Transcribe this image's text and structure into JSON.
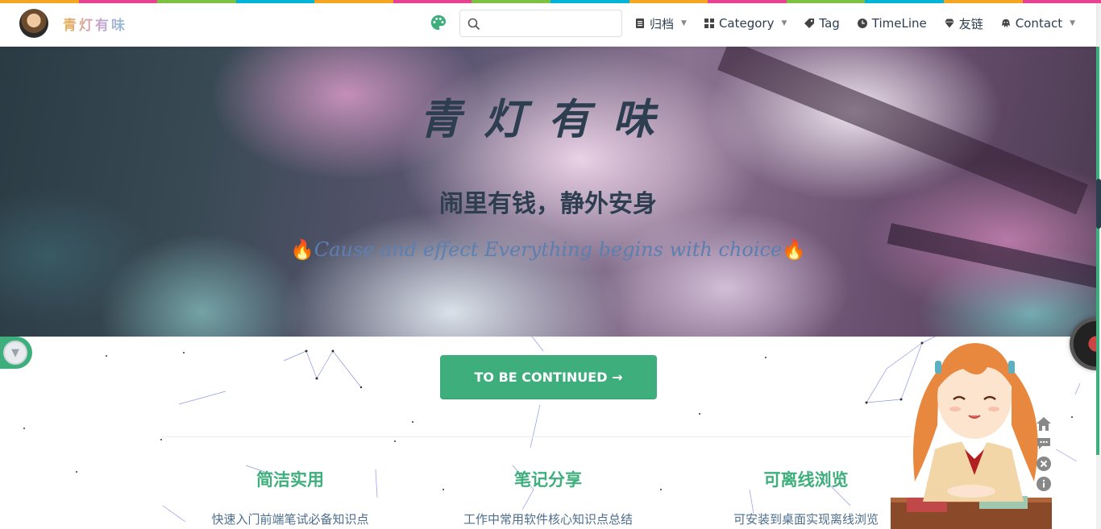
{
  "colors": {
    "accent": "#3eaf7c",
    "text": "#2c3e50",
    "rainbow": [
      "#f5a623",
      "#e84393",
      "#7cc142",
      "#00b4d8",
      "#f5a623",
      "#e84393",
      "#7cc142",
      "#00b4d8",
      "#f5a623",
      "#e84393",
      "#7cc142",
      "#00b4d8",
      "#f5a623",
      "#e84393"
    ]
  },
  "navbar": {
    "site_name": "青灯有味",
    "search": {
      "placeholder": "",
      "value": ""
    },
    "items": [
      {
        "label": "归档",
        "icon": "document-icon",
        "dropdown": true
      },
      {
        "label": "Category",
        "icon": "grid-icon",
        "dropdown": true
      },
      {
        "label": "Tag",
        "icon": "tag-icon",
        "dropdown": false
      },
      {
        "label": "TimeLine",
        "icon": "clock-icon",
        "dropdown": false
      },
      {
        "label": "友链",
        "icon": "diamond-icon",
        "dropdown": false
      },
      {
        "label": "Contact",
        "icon": "octocat-icon",
        "dropdown": true
      }
    ]
  },
  "hero": {
    "title": "青灯有味",
    "subtitle": "闹里有钱，静外安身",
    "tagline": "Cause and effect Everything begins with choice"
  },
  "cta": {
    "label": "TO BE CONTINUED →"
  },
  "features": [
    {
      "title": "简洁实用",
      "details": "快速入门前端笔试必备知识点"
    },
    {
      "title": "笔记分享",
      "details": "工作中常用软件核心知识点总结"
    },
    {
      "title": "可离线浏览",
      "details": "可安装到桌面实现离线浏览"
    }
  ]
}
